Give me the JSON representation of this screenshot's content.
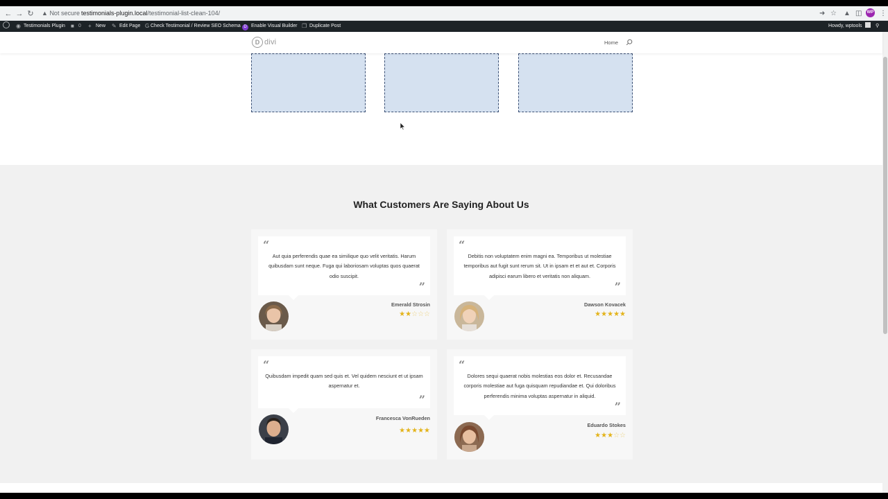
{
  "browser": {
    "security_label": "Not secure",
    "url_host": "testimonials-plugin.local",
    "url_path": "/testimonial-list-clean-104/",
    "profile_initials": "WP"
  },
  "admin_bar": {
    "site_name": "Testimonials Plugin",
    "comments_count": "0",
    "new_label": "New",
    "edit_label": "Edit Page",
    "seo_label": "Check Testimonial / Review SEO Schema",
    "visual_builder_label": "Enable Visual Builder",
    "duplicate_label": "Duplicate Post",
    "greeting": "Howdy, wptools"
  },
  "header": {
    "logo_letter": "D",
    "logo_text": "divi",
    "nav_home": "Home"
  },
  "section": {
    "title": "What Customers Are Saying About Us"
  },
  "testimonials": [
    {
      "text": "Aut quia perferendis quae ea similique quo velit veritatis. Harum quibusdam sunt neque. Fuga qui laboriosam voluptas quos quaerat odio suscipit.",
      "author": "Emerald Strosin",
      "rating": 2,
      "max_rating": 5
    },
    {
      "text": "Debitis non voluptatem enim magni ea. Temporibus ut molestiae temporibus aut fugit sunt rerum sit. Ut in ipsam et et aut et. Corporis adipisci earum libero et veritatis non aliquam.",
      "author": "Dawson Kovacek",
      "rating": 5,
      "max_rating": 5
    },
    {
      "text": "Quibusdam impedit quam sed quis et. Vel quidem nesciunt et ut ipsam aspernatur et.",
      "author": "Francesca VonRueden",
      "rating": 5,
      "max_rating": 5
    },
    {
      "text": "Dolores sequi quaerat nobis molestias eos dolor et. Recusandae corporis molestiae aut fuga quisquam repudiandae et. Qui doloribus perferendis minima voluptas aspernatur in aliquid.",
      "author": "Eduardo Stokes",
      "rating": 3,
      "max_rating": 5
    }
  ],
  "colors": {
    "admin_bar_bg": "#1d2327",
    "star": "#e3b31a",
    "placeholder_fill": "#d5e1f0",
    "section_bg": "#f1f1f1",
    "divi_purple": "#7e3bd0"
  }
}
